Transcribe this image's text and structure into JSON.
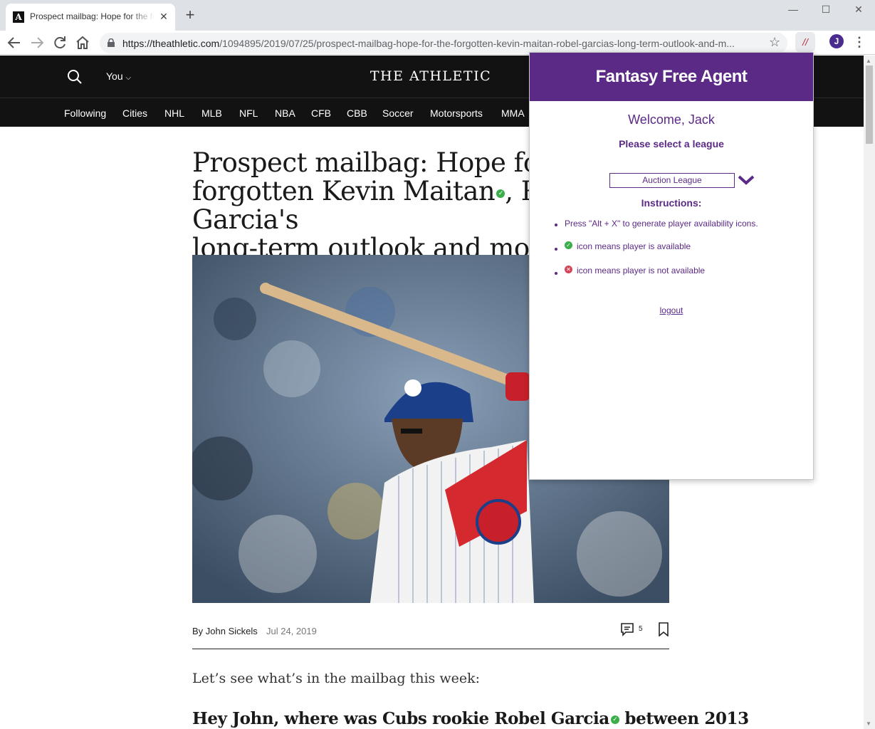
{
  "browser": {
    "tab_title": "Prospect mailbag: Hope for the forgotten Kevin Maitan",
    "tab_favicon": "A",
    "url_host": "https://theathletic.com",
    "url_path": "/1094895/2019/07/25/prospect-mailbag-hope-for-the-forgotten-kevin-maitan-robel-garcias-long-term-outlook-and-m...",
    "profile_initial": "J",
    "icons": [
      "back-icon",
      "forward-icon",
      "reload-icon",
      "home-icon",
      "lock-icon",
      "star-icon",
      "extension-icon",
      "menu-icon",
      "minimize-icon",
      "maximize-icon",
      "close-icon"
    ]
  },
  "site": {
    "brand": "THE ATHLETIC",
    "you_label": "You",
    "nav": [
      "Following",
      "Cities",
      "NHL",
      "MLB",
      "NFL",
      "NBA",
      "CFB",
      "CBB",
      "Soccer",
      "Motorsports",
      "MMA"
    ]
  },
  "article": {
    "headline_1": "Prospect mailbag: Hope for the",
    "headline_2a": "forgotten Kevin Maitan",
    "headline_2b": ", Robel Garcia's",
    "headline_3": "long-term outlook and more",
    "author": "By John Sickels",
    "date": "Jul 24, 2019",
    "comment_count": "5",
    "intro": "Let’s see what’s in the mailbag this week:",
    "subhead_a": "Hey John, where was Cubs rookie Robel Garcia",
    "subhead_b": " between 2013"
  },
  "popup": {
    "title": "Fantasy Free Agent",
    "welcome": "Welcome, Jack",
    "select_prompt": "Please select a league",
    "league": "Auction League",
    "instructions_title": "Instructions:",
    "instruction_1": "Press \"Alt + X\" to generate player availability icons.",
    "instruction_2": "icon means player is available",
    "instruction_3": "icon means player is not available",
    "logout": "logout",
    "colors": {
      "brand": "#5b2a86",
      "available": "#3aae49",
      "unavailable": "#d2465a"
    }
  }
}
